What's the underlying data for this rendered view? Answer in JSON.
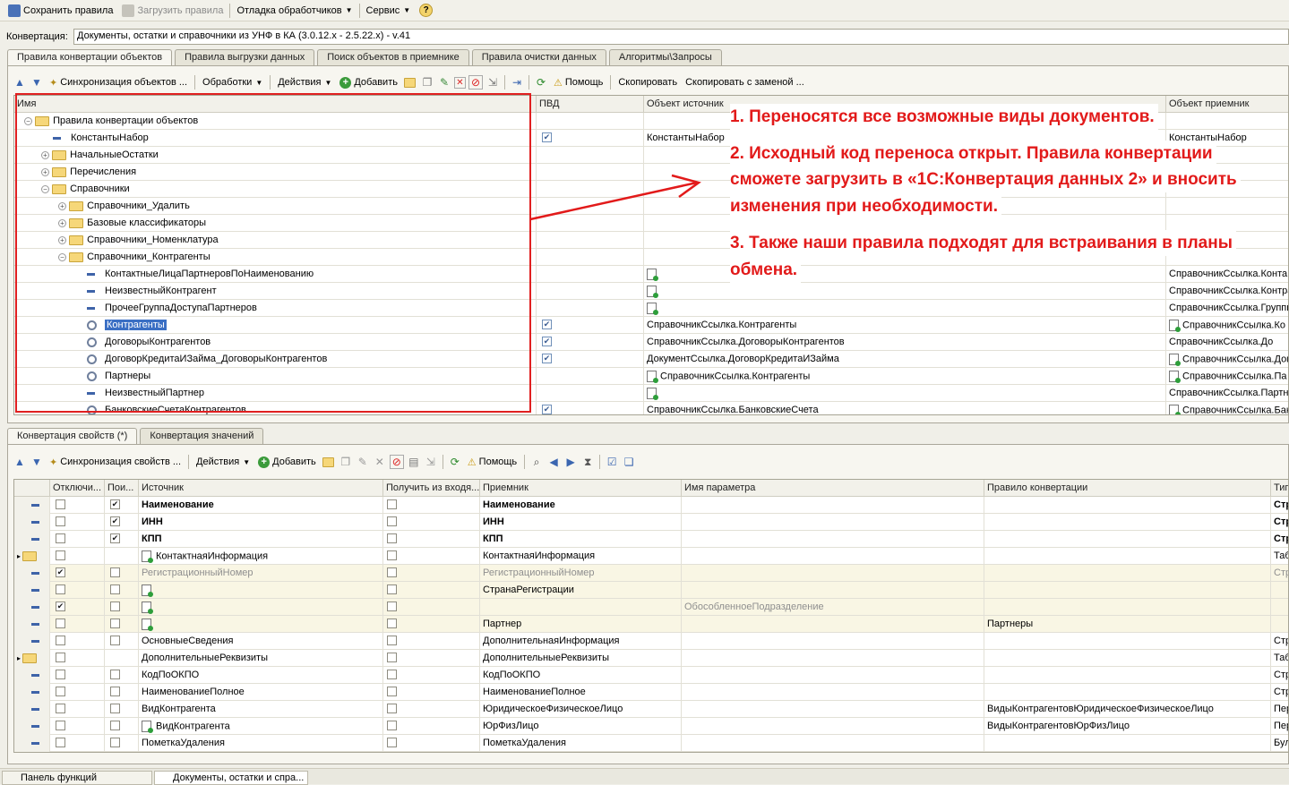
{
  "menu": {
    "save": "Сохранить правила",
    "load": "Загрузить правила",
    "debug": "Отладка обработчиков",
    "service": "Сервис",
    "help": "?"
  },
  "conversion": {
    "label": "Конвертация:",
    "value": "Документы, остатки и справочники из УНФ в КА (3.0.12.x - 2.5.22.x) - v.41"
  },
  "top_tabs": [
    "Правила конвертации объектов",
    "Правила выгрузки данных",
    "Поиск объектов в приемнике",
    "Правила очистки данных",
    "Алгоритмы\\Запросы"
  ],
  "top_toolbar": {
    "sync": "Синхронизация объектов ...",
    "processing": "Обработки",
    "actions": "Действия",
    "add": "Добавить",
    "help": "Помощь",
    "copy": "Скопировать",
    "copy_replace": "Скопировать с заменой ..."
  },
  "top_grid": {
    "headers": [
      "Имя",
      "ПВД",
      "Объект источник",
      "Объект приемник"
    ],
    "rows": [
      {
        "name": "Правила конвертации объектов",
        "pvd": false,
        "src": "",
        "dst": "",
        "level": 0,
        "kind": "folder",
        "exp": "-"
      },
      {
        "name": "КонстантыНабор",
        "pvd": true,
        "src": "КонстантыНабор",
        "dst": "КонстантыНабор",
        "level": 1,
        "kind": "dash",
        "exp": ""
      },
      {
        "name": "НачальныеОстатки",
        "pvd": false,
        "src": "",
        "dst": "",
        "level": 1,
        "kind": "folder",
        "exp": "+"
      },
      {
        "name": "Перечисления",
        "pvd": false,
        "src": "",
        "dst": "",
        "level": 1,
        "kind": "folder",
        "exp": "+"
      },
      {
        "name": "Справочники",
        "pvd": false,
        "src": "",
        "dst": "",
        "level": 1,
        "kind": "folder",
        "exp": "-"
      },
      {
        "name": "Справочники_Удалить",
        "pvd": false,
        "src": "",
        "dst": "",
        "level": 2,
        "kind": "folder",
        "exp": "+"
      },
      {
        "name": "Базовые классификаторы",
        "pvd": false,
        "src": "",
        "dst": "",
        "level": 2,
        "kind": "folder",
        "exp": "+"
      },
      {
        "name": "Справочники_Номенклатура",
        "pvd": false,
        "src": "",
        "dst": "",
        "level": 2,
        "kind": "folder",
        "exp": "+"
      },
      {
        "name": "Справочники_Контрагенты",
        "pvd": false,
        "src": "",
        "dst": "",
        "level": 2,
        "kind": "folder",
        "exp": "-"
      },
      {
        "name": "КонтактныеЛицаПартнеровПоНаименованию",
        "pvd": false,
        "src": "",
        "dst": "СправочникСсылка.Конта",
        "level": 3,
        "kind": "dash",
        "exp": ""
      },
      {
        "name": "НеизвестныйКонтрагент",
        "pvd": false,
        "src": "",
        "dst": "СправочникСсылка.Контра",
        "level": 3,
        "kind": "dash",
        "exp": ""
      },
      {
        "name": "ПрочееГруппаДоступаПартнеров",
        "pvd": false,
        "src": "",
        "dst": "СправочникСсылка.Группы",
        "level": 3,
        "kind": "dash",
        "exp": ""
      },
      {
        "name": "Контрагенты",
        "pvd": true,
        "src": "СправочникСсылка.Контрагенты",
        "dst": "СправочникСсылка.Ко",
        "level": 3,
        "kind": "mag",
        "exp": "",
        "sel": true
      },
      {
        "name": "ДоговорыКонтрагентов",
        "pvd": true,
        "src": "СправочникСсылка.ДоговорыКонтрагентов",
        "dst": "СправочникСсылка.До",
        "level": 3,
        "kind": "mag",
        "exp": ""
      },
      {
        "name": "ДоговорКредитаИЗайма_ДоговорыКонтрагентов",
        "pvd": true,
        "src": "ДокументСсылка.ДоговорКредитаИЗайма",
        "dst": "СправочникСсылка.Догов",
        "level": 3,
        "kind": "mag",
        "exp": ""
      },
      {
        "name": "Партнеры",
        "pvd": false,
        "src": "СправочникСсылка.Контрагенты",
        "dst": "СправочникСсылка.Па",
        "level": 3,
        "kind": "mag",
        "exp": ""
      },
      {
        "name": "НеизвестныйПартнер",
        "pvd": false,
        "src": "",
        "dst": "СправочникСсылка.Партн",
        "level": 3,
        "kind": "dash",
        "exp": ""
      },
      {
        "name": "БанковскиеСчетаКонтрагентов",
        "pvd": true,
        "src": "СправочникСсылка.БанковскиеСчета",
        "dst": "СправочникСсылка.Банко",
        "level": 3,
        "kind": "mag",
        "exp": ""
      }
    ]
  },
  "notes": [
    "1. Переносятся все возможные виды документов.",
    "2. Исходный код переноса открыт. Правила конвертации",
    "сможете загрузить в «1С:Конвертация данных 2» и вносить",
    "изменения при необходимости.",
    "3. Также наши правила подходят для встраивания в планы",
    "обмена."
  ],
  "bottom_tabs": [
    "Конвертация свойств (*)",
    "Конвертация значений"
  ],
  "bottom_toolbar": {
    "sync": "Синхронизация свойств ...",
    "actions": "Действия",
    "add": "Добавить",
    "help": "Помощь"
  },
  "bottom_grid": {
    "headers": [
      "Отключи...",
      "Пои...",
      "Источник",
      "Получить из входя...",
      "Приемник",
      "Имя параметра",
      "Правило конвертации",
      "Тип"
    ],
    "rows": [
      {
        "off": false,
        "search": true,
        "src": "Наименование",
        "get": false,
        "dst": "Наименование",
        "param": "",
        "rule": "",
        "type": "Стр",
        "bold": true,
        "gray": false,
        "folder": false,
        "tint": false
      },
      {
        "off": false,
        "search": true,
        "src": "ИНН",
        "get": false,
        "dst": "ИНН",
        "param": "",
        "rule": "",
        "type": "Стр",
        "bold": true,
        "gray": false,
        "folder": false,
        "tint": false
      },
      {
        "off": false,
        "search": true,
        "src": "КПП",
        "get": false,
        "dst": "КПП",
        "param": "",
        "rule": "",
        "type": "Стр",
        "bold": true,
        "gray": false,
        "folder": false,
        "tint": false
      },
      {
        "off": false,
        "search": null,
        "src": "КонтактнаяИнформация",
        "get": false,
        "dst": "КонтактнаяИнформация",
        "param": "",
        "rule": "",
        "type": "Таб",
        "bold": false,
        "gray": false,
        "folder": true,
        "tint": false,
        "srcdoc": true
      },
      {
        "off": true,
        "search": false,
        "src": "РегистрационныйНомер",
        "get": false,
        "dst": "РегистрационныйНомер",
        "param": "",
        "rule": "",
        "type": "Стр",
        "bold": false,
        "gray": true,
        "folder": false,
        "tint": true
      },
      {
        "off": false,
        "search": false,
        "src": "",
        "get": false,
        "dst": "СтранаРегистрации",
        "param": "",
        "rule": "",
        "type": "",
        "bold": false,
        "gray": false,
        "folder": false,
        "tint": true,
        "srcdoc": true
      },
      {
        "off": true,
        "search": false,
        "src": "",
        "get": false,
        "dst": "",
        "param": "ОбособленноеПодразделение",
        "rule": "",
        "type": "",
        "bold": false,
        "gray": false,
        "folder": false,
        "tint": true,
        "srcdoc": true
      },
      {
        "off": false,
        "search": false,
        "src": "",
        "get": false,
        "dst": "Партнер",
        "param": "",
        "rule": "Партнеры",
        "type": "",
        "bold": false,
        "gray": false,
        "folder": false,
        "tint": true,
        "srcdoc": true
      },
      {
        "off": false,
        "search": false,
        "src": "ОсновныеСведения",
        "get": false,
        "dst": "ДополнительнаяИнформация",
        "param": "",
        "rule": "",
        "type": "Стр",
        "bold": false,
        "gray": false,
        "folder": false,
        "tint": false
      },
      {
        "off": false,
        "search": null,
        "src": "ДополнительныеРеквизиты",
        "get": false,
        "dst": "ДополнительныеРеквизиты",
        "param": "",
        "rule": "",
        "type": "Таб",
        "bold": false,
        "gray": false,
        "folder": true,
        "tint": false
      },
      {
        "off": false,
        "search": false,
        "src": "КодПоОКПО",
        "get": false,
        "dst": "КодПоОКПО",
        "param": "",
        "rule": "",
        "type": "Стр",
        "bold": false,
        "gray": false,
        "folder": false,
        "tint": false
      },
      {
        "off": false,
        "search": false,
        "src": "НаименованиеПолное",
        "get": false,
        "dst": "НаименованиеПолное",
        "param": "",
        "rule": "",
        "type": "Стр",
        "bold": false,
        "gray": false,
        "folder": false,
        "tint": false
      },
      {
        "off": false,
        "search": false,
        "src": "ВидКонтрагента",
        "get": false,
        "dst": "ЮридическоеФизическоеЛицо",
        "param": "",
        "rule": "ВидыКонтрагентовЮридическоеФизическоеЛицо",
        "type": "Пер",
        "bold": false,
        "gray": false,
        "folder": false,
        "tint": false
      },
      {
        "off": false,
        "search": false,
        "src": "ВидКонтрагента",
        "get": false,
        "dst": "ЮрФизЛицо",
        "param": "",
        "rule": "ВидыКонтрагентовЮрФизЛицо",
        "type": "Пер",
        "bold": false,
        "gray": false,
        "folder": false,
        "tint": false,
        "srcdoc": true
      },
      {
        "off": false,
        "search": false,
        "src": "ПометкаУдаления",
        "get": false,
        "dst": "ПометкаУдаления",
        "param": "",
        "rule": "",
        "type": "Бул",
        "bold": false,
        "gray": false,
        "folder": false,
        "tint": false
      }
    ]
  },
  "taskbar": [
    "Панель функций",
    "Документы, остатки и спра..."
  ],
  "colors": {
    "accent_red": "#e21a1a",
    "selection": "#3a6fc4",
    "tint_row": "#f9f6e4"
  }
}
